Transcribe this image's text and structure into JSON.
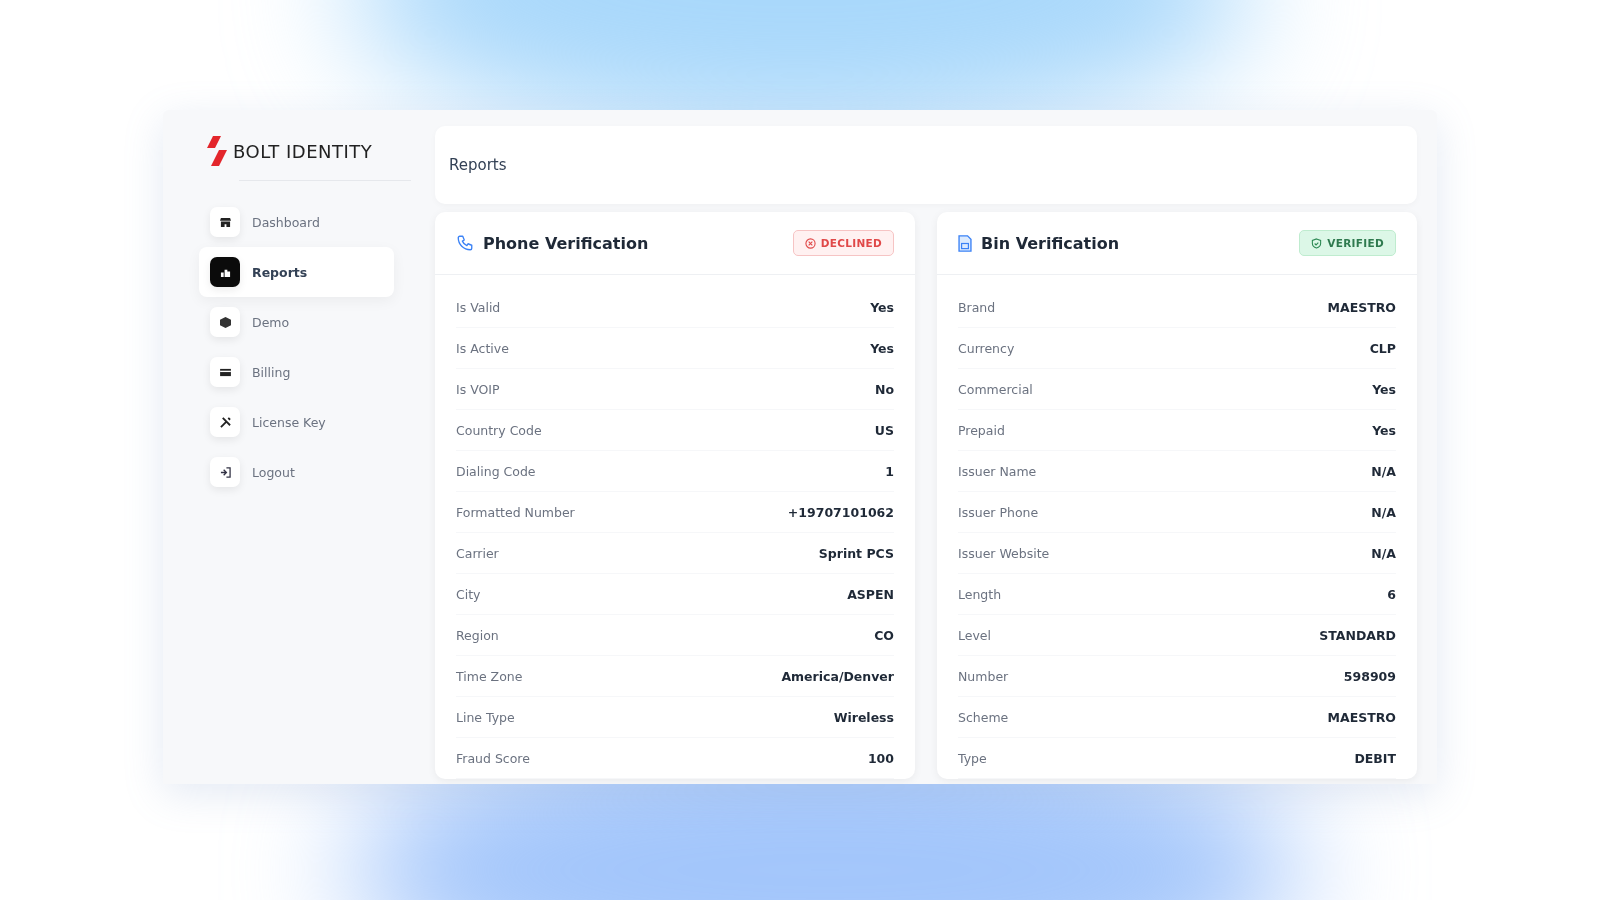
{
  "logo": {
    "text": "BOLT IDENTITY"
  },
  "sidebar": {
    "items": [
      {
        "label": "Dashboard",
        "kind": "store",
        "selected": false
      },
      {
        "label": "Reports",
        "kind": "chart",
        "selected": true
      },
      {
        "label": "Demo",
        "kind": "box",
        "selected": false
      },
      {
        "label": "Billing",
        "kind": "card",
        "selected": false
      },
      {
        "label": "License Key",
        "kind": "tools",
        "selected": false
      },
      {
        "label": "Logout",
        "kind": "logout",
        "selected": false
      }
    ]
  },
  "header": {
    "title": "Reports"
  },
  "cards": [
    {
      "title": "Phone Verification",
      "kind": "phone",
      "status": {
        "kind": "declined",
        "label": "DECLINED"
      },
      "rows": [
        {
          "label": "Is Valid",
          "value": "Yes"
        },
        {
          "label": "Is Active",
          "value": "Yes"
        },
        {
          "label": "Is VOIP",
          "value": "No"
        },
        {
          "label": "Country Code",
          "value": "US"
        },
        {
          "label": "Dialing Code",
          "value": "1"
        },
        {
          "label": "Formatted Number",
          "value": "+19707101062"
        },
        {
          "label": "Carrier",
          "value": "Sprint PCS"
        },
        {
          "label": "City",
          "value": "ASPEN"
        },
        {
          "label": "Region",
          "value": "CO"
        },
        {
          "label": "Time Zone",
          "value": "America/Denver"
        },
        {
          "label": "Line Type",
          "value": "Wireless"
        },
        {
          "label": "Fraud Score",
          "value": "100"
        }
      ]
    },
    {
      "title": "Bin Verification",
      "kind": "bin",
      "status": {
        "kind": "verified",
        "label": "VERIFIED"
      },
      "rows": [
        {
          "label": "Brand",
          "value": "MAESTRO"
        },
        {
          "label": "Currency",
          "value": "CLP"
        },
        {
          "label": "Commercial",
          "value": "Yes"
        },
        {
          "label": "Prepaid",
          "value": "Yes"
        },
        {
          "label": "Issuer Name",
          "value": "N/A"
        },
        {
          "label": "Issuer Phone",
          "value": "N/A"
        },
        {
          "label": "Issuer Website",
          "value": "N/A"
        },
        {
          "label": "Length",
          "value": "6"
        },
        {
          "label": "Level",
          "value": "STANDARD"
        },
        {
          "label": "Number",
          "value": "598909"
        },
        {
          "label": "Scheme",
          "value": "MAESTRO"
        },
        {
          "label": "Type",
          "value": "DEBIT"
        }
      ]
    }
  ]
}
